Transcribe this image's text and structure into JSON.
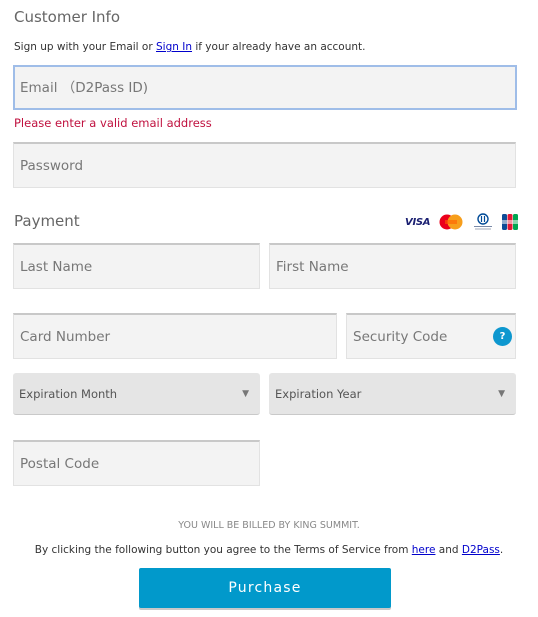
{
  "customer_info": {
    "title": "Customer Info",
    "intro_before": "Sign up with your Email or ",
    "sign_in_link": "Sign In",
    "intro_after": " if your already have an account.",
    "email_placeholder": "Email （D2Pass ID)",
    "email_value": "",
    "email_error": "Please enter a valid email address",
    "password_placeholder": "Password"
  },
  "payment": {
    "title": "Payment",
    "card_brands": [
      {
        "name": "VISA",
        "icon": "visa-logo"
      },
      {
        "name": "MasterCard",
        "icon": "mastercard-logo"
      },
      {
        "name": "Diners Club International",
        "icon": "diners-club-logo"
      },
      {
        "name": "JCB",
        "icon": "jcb-logo"
      }
    ],
    "last_name_placeholder": "Last Name",
    "first_name_placeholder": "First Name",
    "card_number_placeholder": "Card Number",
    "security_code_placeholder": "Security Code",
    "security_help_glyph": "?",
    "expiration_month": "Expiration Month",
    "expiration_year": "Expiration Year",
    "postal_code_placeholder": "Postal Code"
  },
  "footer": {
    "billed_by": "YOU WILL BE BILLED BY KING SUMMIT.",
    "terms_before": "By clicking the following button you agree to the Terms of Service from ",
    "terms_link_here": "here",
    "terms_middle": " and ",
    "terms_link_d2pass": "D2Pass",
    "terms_after": ".",
    "purchase_label": "Purchase"
  },
  "colors": {
    "accent": "#0199cb",
    "error": "#c0113f",
    "focus_border": "#9fbde8",
    "field_bg": "#f3f3f3"
  }
}
